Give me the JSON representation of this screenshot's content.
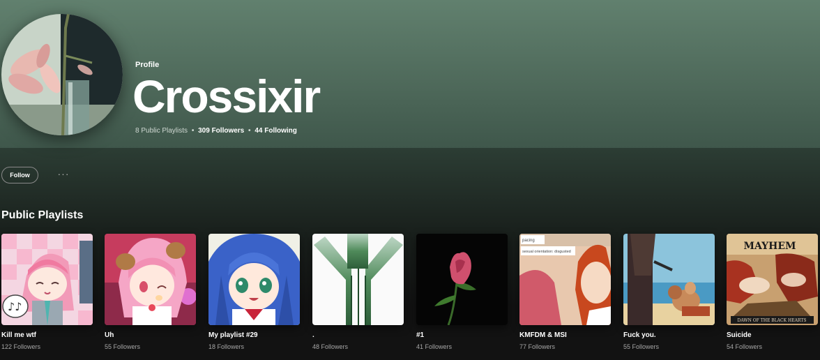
{
  "header": {
    "label": "Profile",
    "name": "Crossixir",
    "stats": {
      "playlists": "8 Public Playlists",
      "followers": "309 Followers",
      "following": "44 Following",
      "separator": "•"
    }
  },
  "actions": {
    "follow_label": "Follow",
    "more_label": "···"
  },
  "section": {
    "title": "Public Playlists"
  },
  "playlists": [
    {
      "title": "Kill me wtf",
      "followers": "122 Followers"
    },
    {
      "title": "Uh",
      "followers": "55 Followers"
    },
    {
      "title": "My playlist #29",
      "followers": "18 Followers"
    },
    {
      "title": ".",
      "followers": "48 Followers"
    },
    {
      "title": "#1",
      "followers": "41 Followers"
    },
    {
      "title": "KMFDM & MSI",
      "followers": "77 Followers",
      "cover_text": {
        "line1": "pacing",
        "line2": "sexual orientation: disgusted"
      }
    },
    {
      "title": "Fuck you.",
      "followers": "55 Followers"
    },
    {
      "title": "Suicide",
      "followers": "54 Followers",
      "cover_text": {
        "logo": "MAYHEM",
        "caption": "DAWN OF THE BLACK HEARTS"
      }
    }
  ],
  "colors": {
    "hero_top": "#61806e",
    "background": "#121212",
    "muted_text": "#a7a7a7"
  }
}
